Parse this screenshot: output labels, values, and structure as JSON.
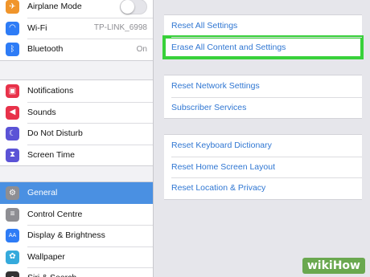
{
  "sidebar": {
    "group1": [
      {
        "label": "Airplane Mode",
        "icon": "airplane-icon",
        "color": "#f0952b",
        "glyph": "✈",
        "toggle": false
      },
      {
        "label": "Wi-Fi",
        "icon": "wifi-icon",
        "color": "#2e7cf6",
        "glyph": "◠",
        "value": "TP-LINK_6998"
      },
      {
        "label": "Bluetooth",
        "icon": "bluetooth-icon",
        "color": "#2e7cf6",
        "glyph": "ᛒ",
        "value": "On"
      }
    ],
    "group2": [
      {
        "label": "Notifications",
        "icon": "notifications-icon",
        "color": "#e8324a",
        "glyph": "▣"
      },
      {
        "label": "Sounds",
        "icon": "speaker-icon",
        "color": "#e8324a",
        "glyph": "◀"
      },
      {
        "label": "Do Not Disturb",
        "icon": "moon-icon",
        "color": "#5b53d6",
        "glyph": "☾"
      },
      {
        "label": "Screen Time",
        "icon": "hourglass-icon",
        "color": "#5b53d6",
        "glyph": "⧗"
      }
    ],
    "group3": [
      {
        "label": "General",
        "icon": "gear-icon",
        "color": "#8e8e93",
        "glyph": "⚙",
        "selected": true
      },
      {
        "label": "Control Centre",
        "icon": "switches-icon",
        "color": "#8e8e93",
        "glyph": "≡"
      },
      {
        "label": "Display & Brightness",
        "icon": "text-size-icon",
        "color": "#2e7cf6",
        "glyph": "AA"
      },
      {
        "label": "Wallpaper",
        "icon": "flower-icon",
        "color": "#35aadc",
        "glyph": "✿"
      },
      {
        "label": "Siri & Search",
        "icon": "siri-icon",
        "color": "#333333",
        "glyph": "●"
      }
    ]
  },
  "main": {
    "group1": [
      "Reset All Settings",
      "Erase All Content and Settings"
    ],
    "group2": [
      "Reset Network Settings",
      "Subscriber Services"
    ],
    "group3": [
      "Reset Keyboard Dictionary",
      "Reset Home Screen Layout",
      "Reset Location & Privacy"
    ],
    "highlighted": "Erase All Content and Settings",
    "highlight_color": "#38d13a",
    "link_color": "#2f76d2"
  },
  "watermark": {
    "part1": "wiki",
    "part2": "How"
  }
}
